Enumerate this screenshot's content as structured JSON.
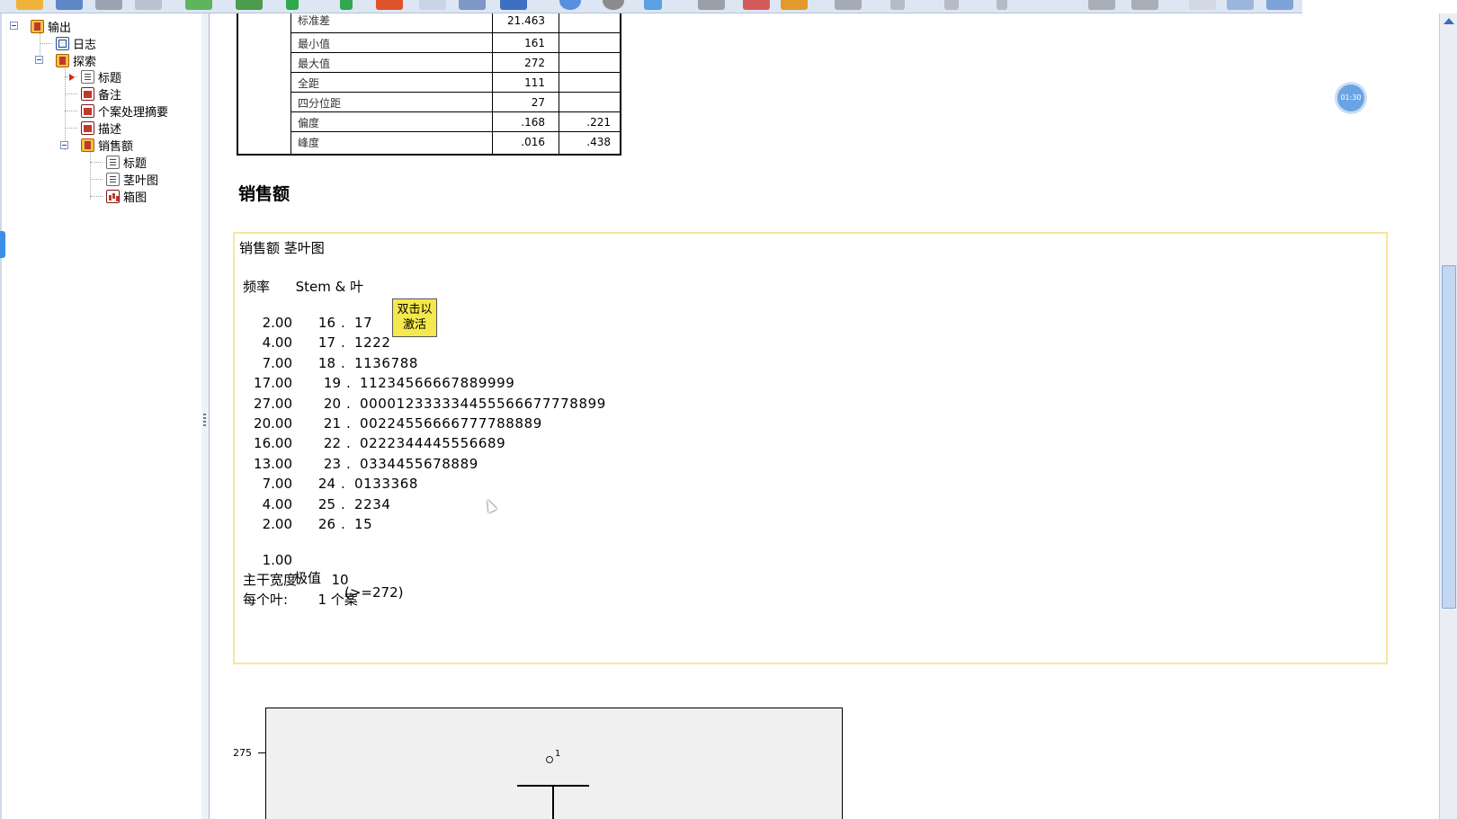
{
  "nav_tree": {
    "items": [
      {
        "label": "输出"
      },
      {
        "label": "日志"
      },
      {
        "label": "探索"
      },
      {
        "label": "标题"
      },
      {
        "label": "备注"
      },
      {
        "label": "个案处理摘要"
      },
      {
        "label": "描述"
      },
      {
        "label": "销售额"
      },
      {
        "label": "标题"
      },
      {
        "label": "茎叶图"
      },
      {
        "label": "箱图"
      }
    ]
  },
  "stats_table": {
    "rows": [
      {
        "label": "标准差",
        "value": "21.463",
        "error": ""
      },
      {
        "label": "最小值",
        "value": "161",
        "error": ""
      },
      {
        "label": "最大值",
        "value": "272",
        "error": ""
      },
      {
        "label": "全距",
        "value": "111",
        "error": ""
      },
      {
        "label": "四分位距",
        "value": "27",
        "error": ""
      },
      {
        "label": "偏度",
        "value": ".168",
        "error": ".221"
      },
      {
        "label": "峰度",
        "value": ".016",
        "error": ".438"
      }
    ]
  },
  "section_title": "销售额",
  "stemleaf": {
    "title": "销售额 茎叶图",
    "header_freq": "频率",
    "header_stem": "Stem & 叶",
    "activate_badge": "双击以\n激活",
    "rows": [
      {
        "freq": "2.00",
        "stem": "16",
        "leaf": "17"
      },
      {
        "freq": "4.00",
        "stem": "17",
        "leaf": "1222"
      },
      {
        "freq": "7.00",
        "stem": "18",
        "leaf": "1136788"
      },
      {
        "freq": "17.00",
        "stem": "19",
        "leaf": "11234566667889999"
      },
      {
        "freq": "27.00",
        "stem": "20",
        "leaf": "000012333334455566677778899"
      },
      {
        "freq": "20.00",
        "stem": "21",
        "leaf": "00224556666777788889"
      },
      {
        "freq": "16.00",
        "stem": "22",
        "leaf": "0222344445556689"
      },
      {
        "freq": "13.00",
        "stem": "23",
        "leaf": "0334455678889"
      },
      {
        "freq": "7.00",
        "stem": "24",
        "leaf": "0133368"
      },
      {
        "freq": "4.00",
        "stem": "25",
        "leaf": "2234"
      },
      {
        "freq": "2.00",
        "stem": "26",
        "leaf": "15"
      }
    ],
    "extreme": {
      "freq": "1.00",
      "label": "极值",
      "value": "(>=272)"
    },
    "stem_width_label": "主干宽度:",
    "stem_width_value": "10",
    "each_leaf_label": "每个叶:",
    "each_leaf_value": "1 个案"
  },
  "boxplot": {
    "y_tick": "275",
    "outlier_label": "1"
  },
  "timer": "01:30",
  "colors": {
    "toolbar_bg": "#dde6f3",
    "stemleaf_border": "#f5e6a3",
    "badge_bg": "#f5e84c",
    "scroll_thumb": "#c4d7f0",
    "timer_bubble": "#6aa4e4"
  }
}
